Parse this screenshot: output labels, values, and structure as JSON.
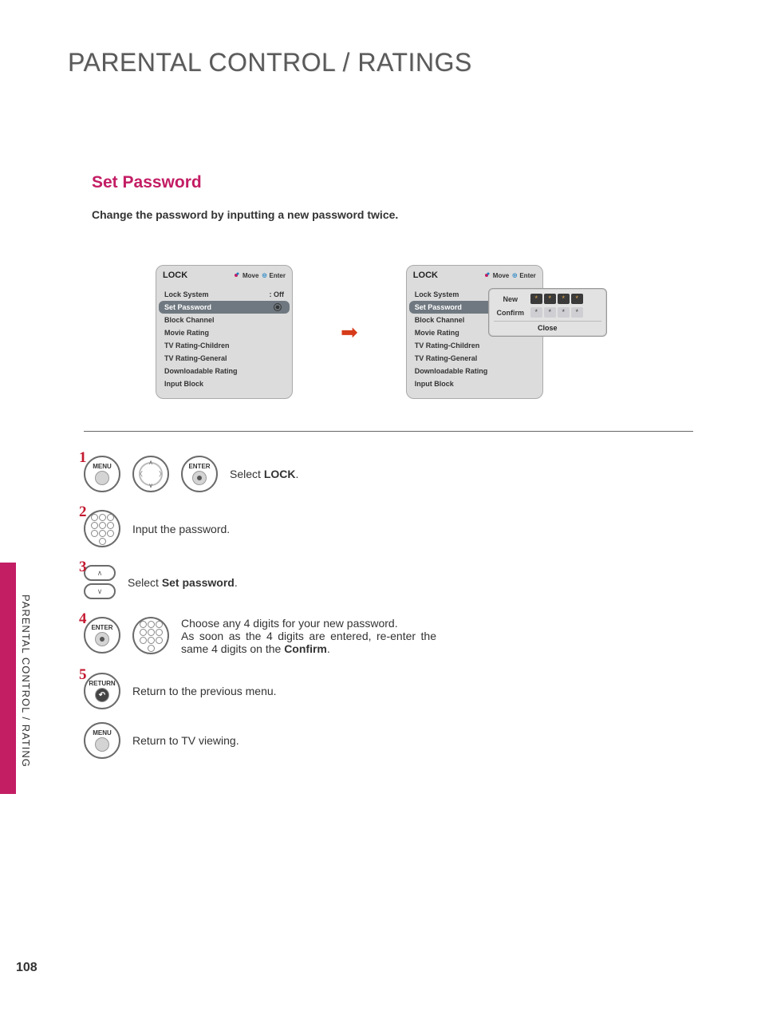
{
  "page_title": "PARENTAL CONTROL / RATINGS",
  "section_title": "Set Password",
  "section_desc": "Change the password by inputting a new password twice.",
  "osd": {
    "title": "LOCK",
    "ctrl_move": "Move",
    "ctrl_enter": "Enter",
    "items": [
      {
        "label": "Lock System",
        "value": ": Off"
      },
      {
        "label": "Set Password",
        "value": ""
      },
      {
        "label": "Block Channel",
        "value": ""
      },
      {
        "label": "Movie Rating",
        "value": ""
      },
      {
        "label": "TV Rating-Children",
        "value": ""
      },
      {
        "label": "TV Rating-General",
        "value": ""
      },
      {
        "label": "Downloadable Rating",
        "value": ""
      },
      {
        "label": "Input Block",
        "value": ""
      }
    ]
  },
  "popup": {
    "new_label": "New",
    "confirm_label": "Confirm",
    "mask_char": "*",
    "close_label": "Close"
  },
  "steps": {
    "s1": {
      "num": "1",
      "btn_menu": "MENU",
      "btn_enter": "ENTER",
      "text_prefix": "Select ",
      "text_bold": "LOCK",
      "text_suffix": "."
    },
    "s2": {
      "num": "2",
      "text": "Input the password."
    },
    "s3": {
      "num": "3",
      "text_prefix": "Select ",
      "text_bold": "Set password",
      "text_suffix": "."
    },
    "s4": {
      "num": "4",
      "btn_enter": "ENTER",
      "line1": "Choose any 4 digits for your new password.",
      "line2_a": "As soon as the 4 digits are entered, re-enter the same 4 digits on the ",
      "line2_bold": "Confirm",
      "line2_b": "."
    },
    "s5": {
      "num": "5",
      "btn_return": "RETURN",
      "text": "Return to the previous menu."
    },
    "s6": {
      "btn_menu": "MENU",
      "text": "Return to TV viewing."
    }
  },
  "spine_text": "PARENTAL CONTROL / RATING",
  "page_number": "108"
}
